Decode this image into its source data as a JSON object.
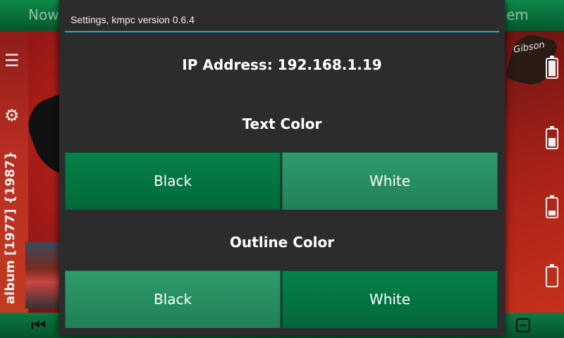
{
  "background_app": {
    "tab_left": "Now",
    "tab_right": "em",
    "brand": "Gibson",
    "vertical_meta": "album  [1977]  {1987}"
  },
  "dialog": {
    "title": "Settings, kmpc version 0.6.4",
    "ip_address": "IP Address: 192.168.1.19",
    "text_color": {
      "label": "Text Color",
      "options": [
        "Black",
        "White"
      ],
      "selected": "Black"
    },
    "outline_color": {
      "label": "Outline Color",
      "options": [
        "Black",
        "White"
      ],
      "selected": "White"
    }
  },
  "colors": {
    "accent_rule": "#2aa6d8",
    "button_selected": "#06824a",
    "button_unselected": "#2f9c6c",
    "dialog_bg": "#2c2c2c"
  }
}
